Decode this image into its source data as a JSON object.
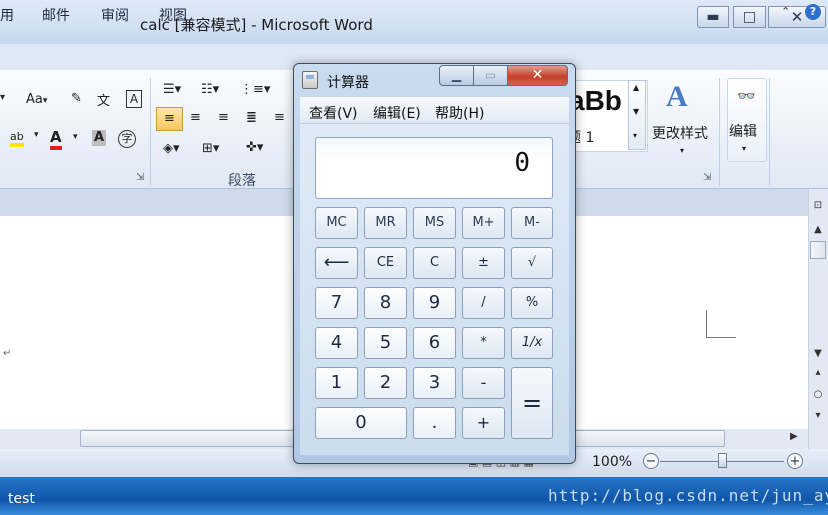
{
  "word": {
    "title": "calc [兼容模式] - Microsoft Word",
    "window_buttons": {
      "minimize": "▬",
      "maximize": "□",
      "close": "✕"
    },
    "tabs": [
      "用",
      "邮件",
      "审阅",
      "视图"
    ],
    "ribbon": {
      "font_size_label": "Aa",
      "wen_label": "文",
      "char_border_label": "A",
      "group_paragraph": "段落",
      "style_preview": "aBb",
      "style_heading": "题 1",
      "change_styles": "更改样式",
      "edit": "编辑"
    },
    "zoom": "100%",
    "zoom_minus": "−",
    "zoom_plus": "+",
    "zoom_percent": 100
  },
  "taskbar": {
    "item": "test",
    "watermark": "http://blog.csdn.net/jun_ay"
  },
  "calc": {
    "title": "计算器",
    "window_buttons": {
      "minimize": "▁",
      "maximize": "▭",
      "close": "✕"
    },
    "menu": [
      "查看(V)",
      "编辑(E)",
      "帮助(H)"
    ],
    "display": "0",
    "memory_keys": [
      "MC",
      "MR",
      "MS",
      "M+",
      "M-"
    ],
    "row2": [
      "⟵",
      "CE",
      "C",
      "±",
      "√"
    ],
    "row3": [
      "7",
      "8",
      "9",
      "/",
      "%"
    ],
    "row4": [
      "4",
      "5",
      "6",
      "*",
      "1/x"
    ],
    "row5": [
      "1",
      "2",
      "3",
      "-"
    ],
    "row6": [
      "0",
      ".",
      "+"
    ],
    "equals": "="
  }
}
